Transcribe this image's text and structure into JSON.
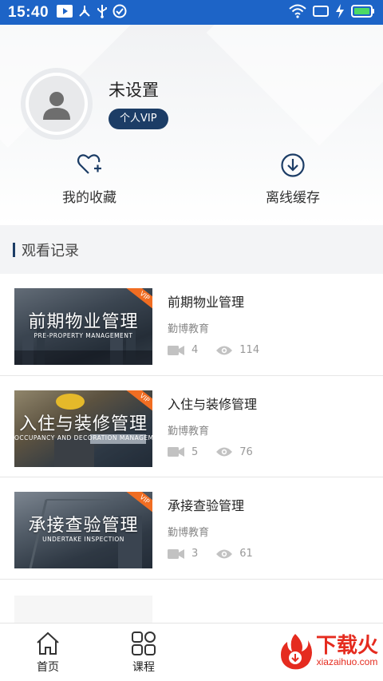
{
  "status_bar": {
    "time": "15:40"
  },
  "profile": {
    "username": "未设置",
    "badge": "个人VIP",
    "actions": [
      {
        "label": "我的收藏",
        "icon": "heart-plus-icon"
      },
      {
        "label": "离线缓存",
        "icon": "download-circle-icon"
      }
    ]
  },
  "history": {
    "title": "观看记录",
    "items": [
      {
        "thumb_title": "前期物业管理",
        "thumb_sub": "PRE-PROPERTY MANAGEMENT",
        "title": "前期物业管理",
        "org": "勤博教育",
        "videos": "4",
        "views": "114",
        "vip": "VIP"
      },
      {
        "thumb_title": "入住与装修管理",
        "thumb_sub": "OCCUPANCY AND DECORATION MANAGEMENT",
        "title": "入住与装修管理",
        "org": "勤博教育",
        "videos": "5",
        "views": "76",
        "vip": "VIP"
      },
      {
        "thumb_title": "承接查验管理",
        "thumb_sub": "UNDERTAKE INSPECTION",
        "title": "承接查验管理",
        "org": "勤博教育",
        "videos": "3",
        "views": "61",
        "vip": "VIP"
      }
    ]
  },
  "bottom_nav": {
    "items": [
      {
        "label": "首页",
        "icon": "home-icon"
      },
      {
        "label": "课程",
        "icon": "grid-icon"
      }
    ]
  },
  "watermark": {
    "text": "下载火",
    "sub": "xiazaihuo.com"
  },
  "colors": {
    "status_bar": "#1d64c7",
    "vip_badge": "#1c3d66",
    "vip_flag": "#f06d22",
    "watermark": "#e52b1f"
  }
}
